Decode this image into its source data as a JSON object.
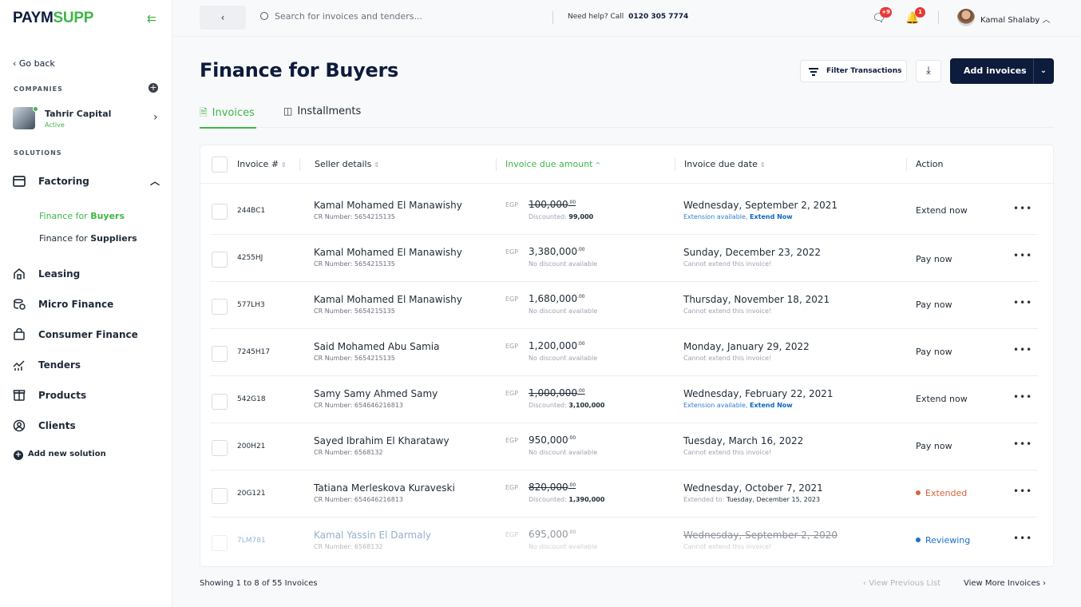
{
  "brand": {
    "logo_part1": "PAYM",
    "logo_part2": "SUPP"
  },
  "sidebar": {
    "go_back": "‹  Go back",
    "companies_label": "COMPANIES",
    "company": {
      "name": "Tahrir Capital",
      "status": "Active"
    },
    "solutions_label": "SOLUTIONS",
    "items": [
      {
        "label": "Factoring",
        "icon": "factoring-icon"
      },
      {
        "label": "Leasing",
        "icon": "leasing-icon"
      },
      {
        "label": "Micro Finance",
        "icon": "micro-finance-icon"
      },
      {
        "label": "Consumer Finance",
        "icon": "consumer-finance-icon"
      },
      {
        "label": "Tenders",
        "icon": "tenders-icon"
      },
      {
        "label": "Products",
        "icon": "products-icon"
      },
      {
        "label": "Clients",
        "icon": "clients-icon"
      }
    ],
    "sub_items": [
      {
        "prefix": "Finance for ",
        "bold": "Buyers"
      },
      {
        "prefix": "Finance for ",
        "bold": "Suppliers"
      }
    ],
    "add_solution": "Add new solution"
  },
  "topbar": {
    "search_placeholder": "Search for invoices and tenders...",
    "help_text": "Need help?  Call",
    "help_phone": "0120 305 7774",
    "messages_badge": "+9",
    "notifications_badge": "1",
    "user_name": "Kamal Shalaby"
  },
  "header": {
    "title": "Finance for Buyers",
    "filter_label": "Filter Transactions",
    "add_label": "Add invoices"
  },
  "tabs": [
    {
      "label": "Invoices",
      "active": true
    },
    {
      "label": "Installments",
      "active": false
    }
  ],
  "table": {
    "columns": {
      "invoice": "Invoice #",
      "seller": "Seller details",
      "amount": "Invoice due amount",
      "due_date": "Invoice due date",
      "action": "Action"
    },
    "rows": [
      {
        "invoice": "244BC1",
        "seller": "Kamal Mohamed El Manawishy",
        "cr": "CR Number: 5654215135",
        "currency": "EGP",
        "amount": "100,000",
        "decimals": ".00",
        "disc_label": "Discounted:",
        "disc_value": "99,000",
        "due": "Wednesday, September 2, 2021",
        "note": "Extension available,",
        "note_link": "Extend Now",
        "action": "Extend now"
      },
      {
        "invoice": "4255HJ",
        "seller": "Kamal Mohamed El Manawishy",
        "cr": "CR Number: 5654215135",
        "currency": "EGP",
        "amount": "3,380,000",
        "decimals": ".00",
        "disc_label": "No discount available",
        "disc_value": "",
        "due": "Sunday, December 23, 2022",
        "note": "Cannot extend this invoice!",
        "note_link": "",
        "action": "Pay now"
      },
      {
        "invoice": "577LH3",
        "seller": "Kamal Mohamed El Manawishy",
        "cr": "CR Number: 5654215135",
        "currency": "EGP",
        "amount": "1,680,000",
        "decimals": ".00",
        "disc_label": "No discount available",
        "disc_value": "",
        "due": "Thursday, November 18, 2021",
        "note": "Cannot extend this invoice!",
        "note_link": "",
        "action": "Pay now"
      },
      {
        "invoice": "7245H17",
        "seller": "Said Mohamed Abu Samia",
        "cr": "CR Number: 5654215135",
        "currency": "EGP",
        "amount": "1,200,000",
        "decimals": ".00",
        "disc_label": "No discount available",
        "disc_value": "",
        "due": "Monday, January 29, 2022",
        "note": "Cannot extend this invoice!",
        "note_link": "",
        "action": "Pay now"
      },
      {
        "invoice": "542G18",
        "seller": "Samy Samy Ahmed Samy",
        "cr": "CR Number: 654646216813",
        "currency": "EGP",
        "amount": "1,000,000",
        "decimals": ".00",
        "disc_label": "Discounted:",
        "disc_value": "3,100,000",
        "due": "Wednesday, February 22, 2021",
        "note": "Extension available,",
        "note_link": "Extend Now",
        "action": "Extend now"
      },
      {
        "invoice": "200H21",
        "seller": "Sayed Ibrahim El Kharatawy",
        "cr": "CR Number: 6568132",
        "currency": "EGP",
        "amount": "950,000",
        "decimals": ".00",
        "disc_label": "No discount available",
        "disc_value": "",
        "due": "Tuesday, March 16, 2022",
        "note": "Cannot extend this invoice!",
        "note_link": "",
        "action": "Pay now"
      },
      {
        "invoice": "20G121",
        "seller": "Tatiana Merleskova Kuraveski",
        "cr": "CR Number: 654646216813",
        "currency": "EGP",
        "amount": "820,000",
        "decimals": ".00",
        "disc_label": "Discounted:",
        "disc_value": "1,390,000",
        "due": "Wednesday, October 7, 2021",
        "note": "Extended to:",
        "note_link": "Tuesday, December 15, 2023",
        "action": "Extended"
      },
      {
        "invoice": "7LM781",
        "seller": "Kamal Yassin El Darmaly",
        "cr": "CR Number: 6568132",
        "currency": "EGP",
        "amount": "695,000",
        "decimals": ".00",
        "disc_label": "No discount available",
        "disc_value": "",
        "due": "Wednesday, September 2, 2020",
        "note": "Cannot extend this invoice!",
        "note_link": "",
        "action": "Reviewing"
      }
    ]
  },
  "footer": {
    "showing": "Showing 1 to 8 of 55 Invoices",
    "prev": "View Previous List",
    "next": "View More Invoices"
  },
  "colors": {
    "accent": "#3fb549",
    "navy": "#0d1b3d",
    "extended": "#d9623b",
    "reviewing": "#1f6fd1",
    "link": "#0b66c3"
  }
}
